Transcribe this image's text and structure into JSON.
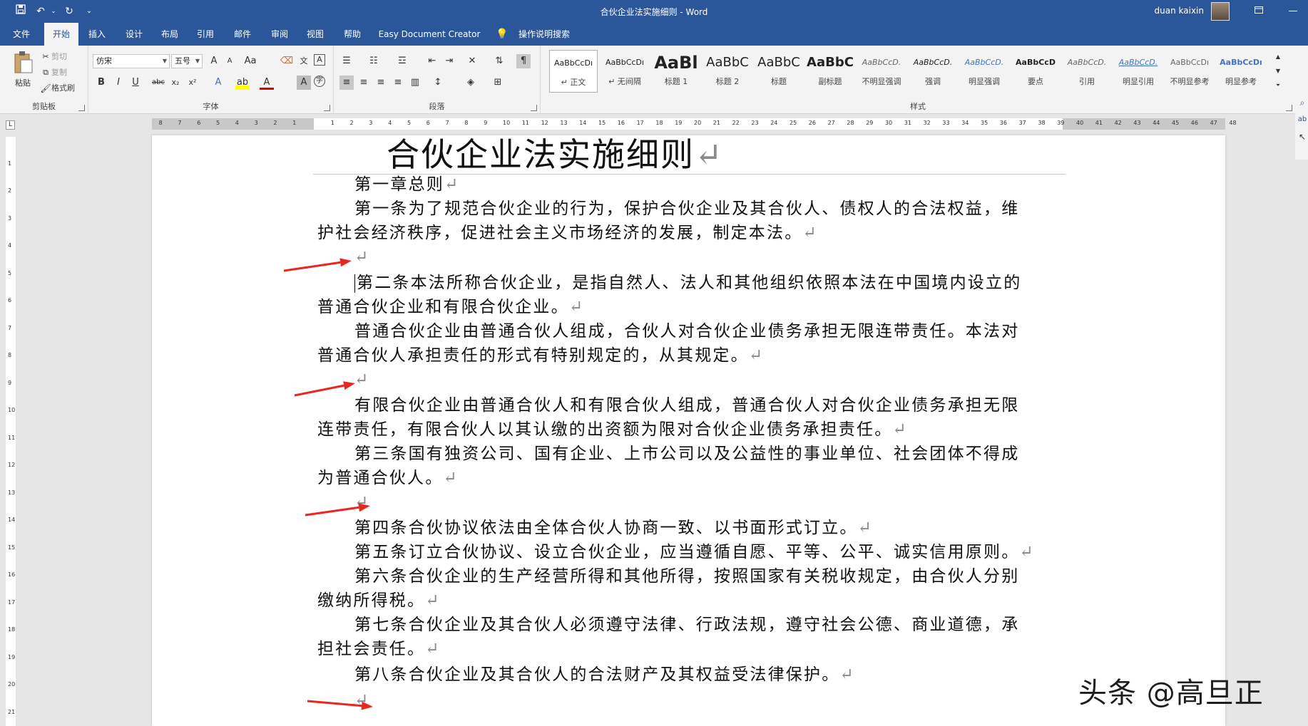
{
  "window": {
    "title": "合伙企业法实施细则  -  Word",
    "user": "duan kaixin",
    "quick_access": {
      "save_icon": "save-icon",
      "undo_icon": "undo-icon",
      "redo_icon": "redo-icon",
      "more_icon": "customize-qat-icon"
    }
  },
  "tabs": [
    {
      "label": "文件"
    },
    {
      "label": "开始"
    },
    {
      "label": "插入"
    },
    {
      "label": "设计"
    },
    {
      "label": "布局"
    },
    {
      "label": "引用"
    },
    {
      "label": "邮件"
    },
    {
      "label": "审阅"
    },
    {
      "label": "视图"
    },
    {
      "label": "帮助"
    },
    {
      "label": "Easy Document Creator"
    },
    {
      "label": "操作说明搜索"
    }
  ],
  "ribbon": {
    "clipboard": {
      "label": "剪贴板",
      "paste": "粘贴",
      "cut": "剪切",
      "copy": "复制",
      "format_painter": "格式刷"
    },
    "font": {
      "label": "字体",
      "font_name": "仿宋",
      "font_size": "五号",
      "grow": "A",
      "shrink": "A",
      "case": "Aa",
      "bold": "B",
      "italic": "I",
      "underline": "U",
      "strike": "abc",
      "subscript": "x₂",
      "superscript": "x²"
    },
    "paragraph": {
      "label": "段落"
    },
    "styles": {
      "label": "样式",
      "items": [
        {
          "preview": "AaBbCcDı",
          "label": "↵ 正文"
        },
        {
          "preview": "AaBbCcDı",
          "label": "↵ 无间隔"
        },
        {
          "preview": "AaBl",
          "label": "标题 1"
        },
        {
          "preview": "AaBbC",
          "label": "标题 2"
        },
        {
          "preview": "AaBbC",
          "label": "标题"
        },
        {
          "preview": "AaBbC",
          "label": "副标题"
        },
        {
          "preview": "AaBbCcD.",
          "label": "不明显强调"
        },
        {
          "preview": "AaBbCcD.",
          "label": "强调"
        },
        {
          "preview": "AaBbCcD.",
          "label": "明显强调"
        },
        {
          "preview": "AaBbCcD",
          "label": "要点"
        },
        {
          "preview": "AaBbCcD.",
          "label": "引用"
        },
        {
          "preview": "AaBbCcD.",
          "label": "明显引用"
        },
        {
          "preview": "AaBbCcDı",
          "label": "不明显参考"
        },
        {
          "preview": "AaBbCcDı",
          "label": "明显参考"
        }
      ]
    }
  },
  "document": {
    "title": "合伙企业法实施细则",
    "paragraphs": [
      "第一章总则",
      "第一条为了规范合伙企业的行为，保护合伙企业及其合伙人、债权人的合法权益，维",
      "护社会经济秩序，促进社会主义市场经济的发展，制定本法。",
      "",
      "第二条本法所称合伙企业，是指自然人、法人和其他组织依照本法在中国境内设立的",
      "普通合伙企业和有限合伙企业。",
      "普通合伙企业由普通合伙人组成，合伙人对合伙企业债务承担无限连带责任。本法对",
      "普通合伙人承担责任的形式有特别规定的，从其规定。",
      "",
      "有限合伙企业由普通合伙人和有限合伙人组成，普通合伙人对合伙企业债务承担无限",
      "连带责任，有限合伙人以其认缴的出资额为限对合伙企业债务承担责任。",
      "第三条国有独资公司、国有企业、上市公司以及公益性的事业单位、社会团体不得成",
      "为普通合伙人。",
      "",
      "第四条合伙协议依法由全体合伙人协商一致、以书面形式订立。",
      "第五条订立合伙协议、设立合伙企业，应当遵循自愿、平等、公平、诚实信用原则。",
      "第六条合伙企业的生产经营所得和其他所得，按照国家有关税收规定，由合伙人分别",
      "缴纳所得税。",
      "第七条合伙企业及其合伙人必须遵守法律、行政法规，遵守社会公德、商业道德，承",
      "担社会责任。",
      "第八条合伙企业及其合伙人的合法财产及其权益受法律保护。",
      ""
    ],
    "para_mark": "↵"
  },
  "watermark": "头条 @高旦正",
  "colors": {
    "ribbon_blue": "#2b579a",
    "arrow_red": "#e8271f"
  }
}
